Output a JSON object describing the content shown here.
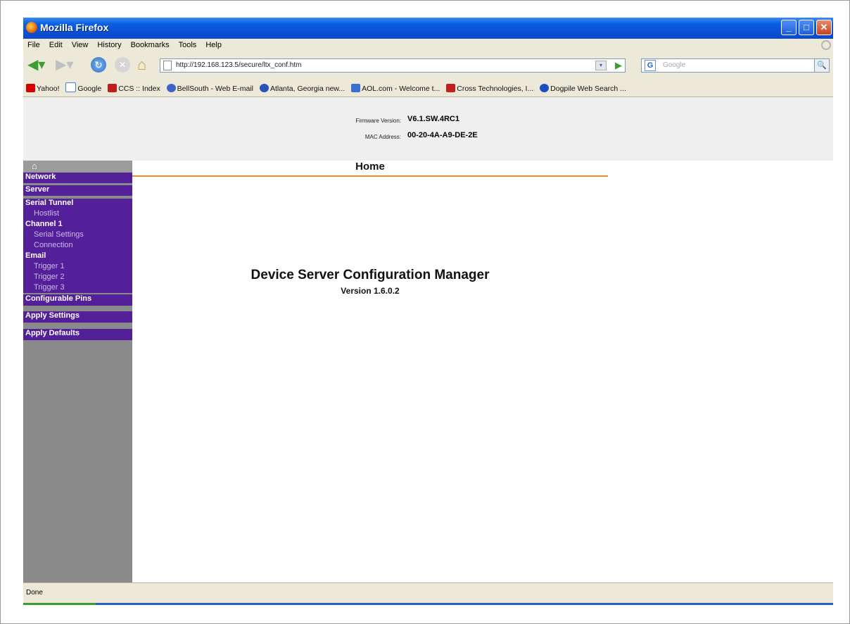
{
  "window": {
    "title": "Mozilla Firefox",
    "controls": {
      "minimize": "_",
      "maximize": "□",
      "close": "✕"
    }
  },
  "menu": [
    "File",
    "Edit",
    "View",
    "History",
    "Bookmarks",
    "Tools",
    "Help"
  ],
  "navigation": {
    "url": "http://192.168.123.5/secure/ltx_conf.htm",
    "search_placeholder": "Google",
    "search_engine_icon": "G"
  },
  "bookmarks": [
    {
      "label": "Yahoo!",
      "icon": "yahoo-icon",
      "color": "#d40000"
    },
    {
      "label": "Google",
      "icon": "google-icon",
      "color": "#4a7fd6"
    },
    {
      "label": "CCS :: Index",
      "icon": "ccs-icon",
      "color": "#c01e1e"
    },
    {
      "label": "BellSouth - Web E-mail",
      "icon": "bellsouth-icon",
      "color": "#3e63c8"
    },
    {
      "label": "Atlanta, Georgia new...",
      "icon": "ajc-icon",
      "color": "#2a52b8"
    },
    {
      "label": "AOL.com - Welcome t...",
      "icon": "aol-icon",
      "color": "#3a6fd1"
    },
    {
      "label": "Cross Technologies, I...",
      "icon": "cross-icon",
      "color": "#c02020"
    },
    {
      "label": "Dogpile Web Search ...",
      "icon": "dogpile-icon",
      "color": "#1a4fc1"
    }
  ],
  "device": {
    "firmware_label": "Firmware Version:",
    "firmware_value": "V6.1.SW.4RC1",
    "mac_label": "MAC Address:",
    "mac_value": "00-20-4A-A9-DE-2E"
  },
  "sidebar": {
    "home_icon": "⌂",
    "items": [
      {
        "label": "Network",
        "type": "section"
      },
      {
        "label": "Server",
        "type": "section"
      },
      {
        "label": "Serial Tunnel",
        "type": "section"
      },
      {
        "label": "Hostlist",
        "type": "sub"
      },
      {
        "label": "Channel 1",
        "type": "section"
      },
      {
        "label": "Serial Settings",
        "type": "sub"
      },
      {
        "label": "Connection",
        "type": "sub"
      },
      {
        "label": "Email",
        "type": "section"
      },
      {
        "label": "Trigger 1",
        "type": "sub"
      },
      {
        "label": "Trigger 2",
        "type": "sub"
      },
      {
        "label": "Trigger 3",
        "type": "sub"
      },
      {
        "label": "Configurable Pins",
        "type": "section"
      },
      {
        "label": "Apply Settings",
        "type": "section"
      },
      {
        "label": "Apply Defaults",
        "type": "section"
      }
    ]
  },
  "main": {
    "page_title": "Home",
    "app_name": "Device Server Configuration Manager",
    "app_version": "Version 1.6.0.2"
  },
  "status": {
    "text": "Done"
  },
  "colors": {
    "sidebar_purple": "#54209a",
    "home_underline": "#ef8f2a",
    "sidebar_gray": "#8a8a8a"
  }
}
